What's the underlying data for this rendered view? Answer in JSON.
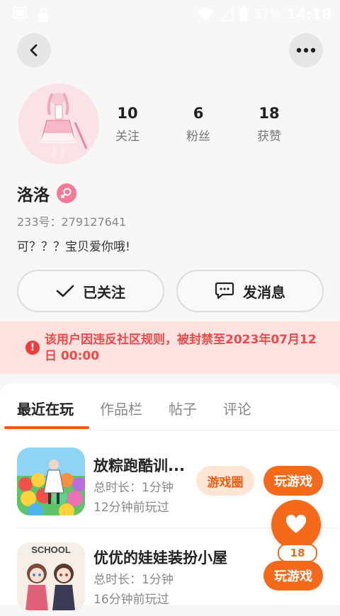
{
  "status_bar": {
    "battery_pct": "37%",
    "time": "14:18"
  },
  "profile": {
    "stats": [
      {
        "num": "10",
        "label": "关注"
      },
      {
        "num": "6",
        "label": "粉丝"
      },
      {
        "num": "18",
        "label": "获赞"
      }
    ],
    "nickname": "洛洛",
    "uid": "233号：279127641",
    "bio": "可？？？宝贝爱你哦!"
  },
  "actions": {
    "follow_label": "已关注",
    "message_label": "发消息"
  },
  "ban_notice": "该用户因违反社区规则，被封禁至2023年07月12日 00:00",
  "tabs": [
    "最近在玩",
    "作品栏",
    "帖子",
    "评论"
  ],
  "games": [
    {
      "name": "放粽跑酷训...",
      "duration": "总时长：1分钟",
      "last_played": "12分钟前玩过",
      "circle_label": "游戏圈",
      "play_label": "玩游戏"
    },
    {
      "name": "优优的娃娃装扮小屋",
      "duration": "总时长：1分钟",
      "last_played": "16分钟前玩过",
      "icon_text": "SCHOOL",
      "play_label": "玩游戏"
    }
  ],
  "like": {
    "count": "18"
  },
  "colors": {
    "accent": "#f56a1a",
    "ban_text": "#ec4a48",
    "ban_bg": "#fde2e0",
    "gender": "#f37b9a"
  }
}
